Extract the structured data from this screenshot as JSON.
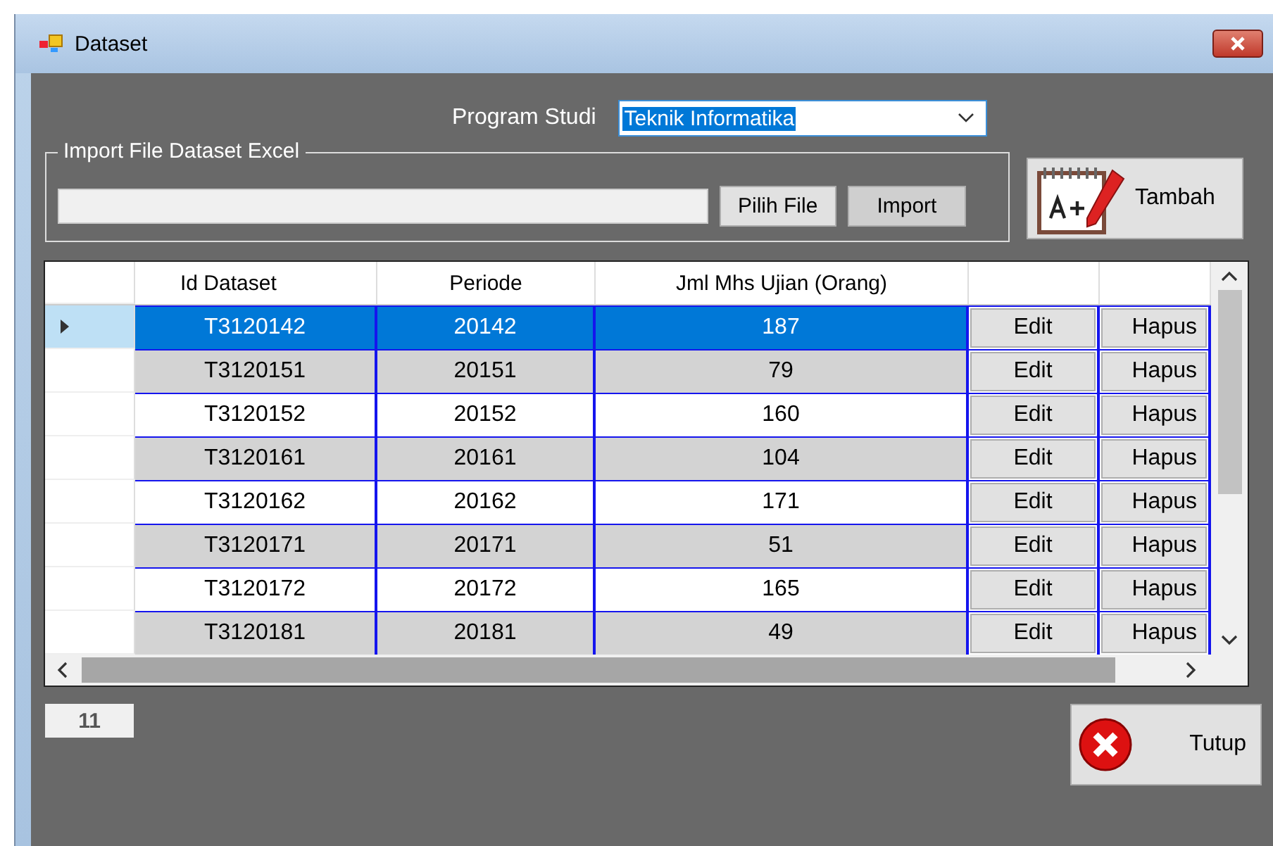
{
  "window": {
    "title": "Dataset"
  },
  "program_studi": {
    "label": "Program Studi",
    "value": "Teknik Informatika"
  },
  "import_group": {
    "title": "Import File Dataset Excel",
    "pick_button": "Pilih File",
    "import_button": "Import"
  },
  "add_button": "Tambah",
  "table": {
    "columns": [
      "Id Dataset",
      "Periode",
      "Jml Mhs Ujian (Orang)"
    ],
    "rows": [
      {
        "selected": true,
        "id": "T3120142",
        "periode": "20142",
        "jml": "187",
        "edit": "Edit",
        "hapus": "Hapus"
      },
      {
        "selected": false,
        "id": "T3120151",
        "periode": "20151",
        "jml": "79",
        "edit": "Edit",
        "hapus": "Hapus"
      },
      {
        "selected": false,
        "id": "T3120152",
        "periode": "20152",
        "jml": "160",
        "edit": "Edit",
        "hapus": "Hapus"
      },
      {
        "selected": false,
        "id": "T3120161",
        "periode": "20161",
        "jml": "104",
        "edit": "Edit",
        "hapus": "Hapus"
      },
      {
        "selected": false,
        "id": "T3120162",
        "periode": "20162",
        "jml": "171",
        "edit": "Edit",
        "hapus": "Hapus"
      },
      {
        "selected": false,
        "id": "T3120171",
        "periode": "20171",
        "jml": "51",
        "edit": "Edit",
        "hapus": "Hapus"
      },
      {
        "selected": false,
        "id": "T3120172",
        "periode": "20172",
        "jml": "165",
        "edit": "Edit",
        "hapus": "Hapus"
      },
      {
        "selected": false,
        "id": "T3120181",
        "periode": "20181",
        "jml": "49",
        "edit": "Edit",
        "hapus": "Hapus"
      }
    ]
  },
  "count": "11",
  "close_button": "Tutup"
}
